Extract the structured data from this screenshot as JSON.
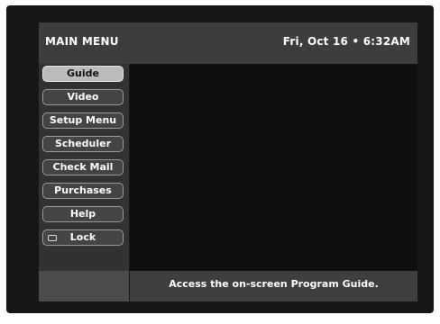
{
  "header": {
    "title": "MAIN MENU",
    "datetime": "Fri, Oct 16 • 6:32AM"
  },
  "menu": {
    "selected": "Guide",
    "items": [
      {
        "label": "Guide"
      },
      {
        "label": "Video"
      },
      {
        "label": "Setup Menu"
      },
      {
        "label": "Scheduler"
      },
      {
        "label": "Check Mail"
      },
      {
        "label": "Purchases"
      },
      {
        "label": "Help"
      },
      {
        "label": "Lock",
        "icon": "lock-icon"
      }
    ]
  },
  "footer": {
    "description": "Access the on-screen Program Guide."
  },
  "colors": {
    "screen_background": "#161616",
    "header_bar": "#3d3d3d",
    "selected_item": "#bcbcbc",
    "menu_item": "#444444",
    "footer_bar": "#3f3f3f",
    "text": "#ffffff"
  }
}
